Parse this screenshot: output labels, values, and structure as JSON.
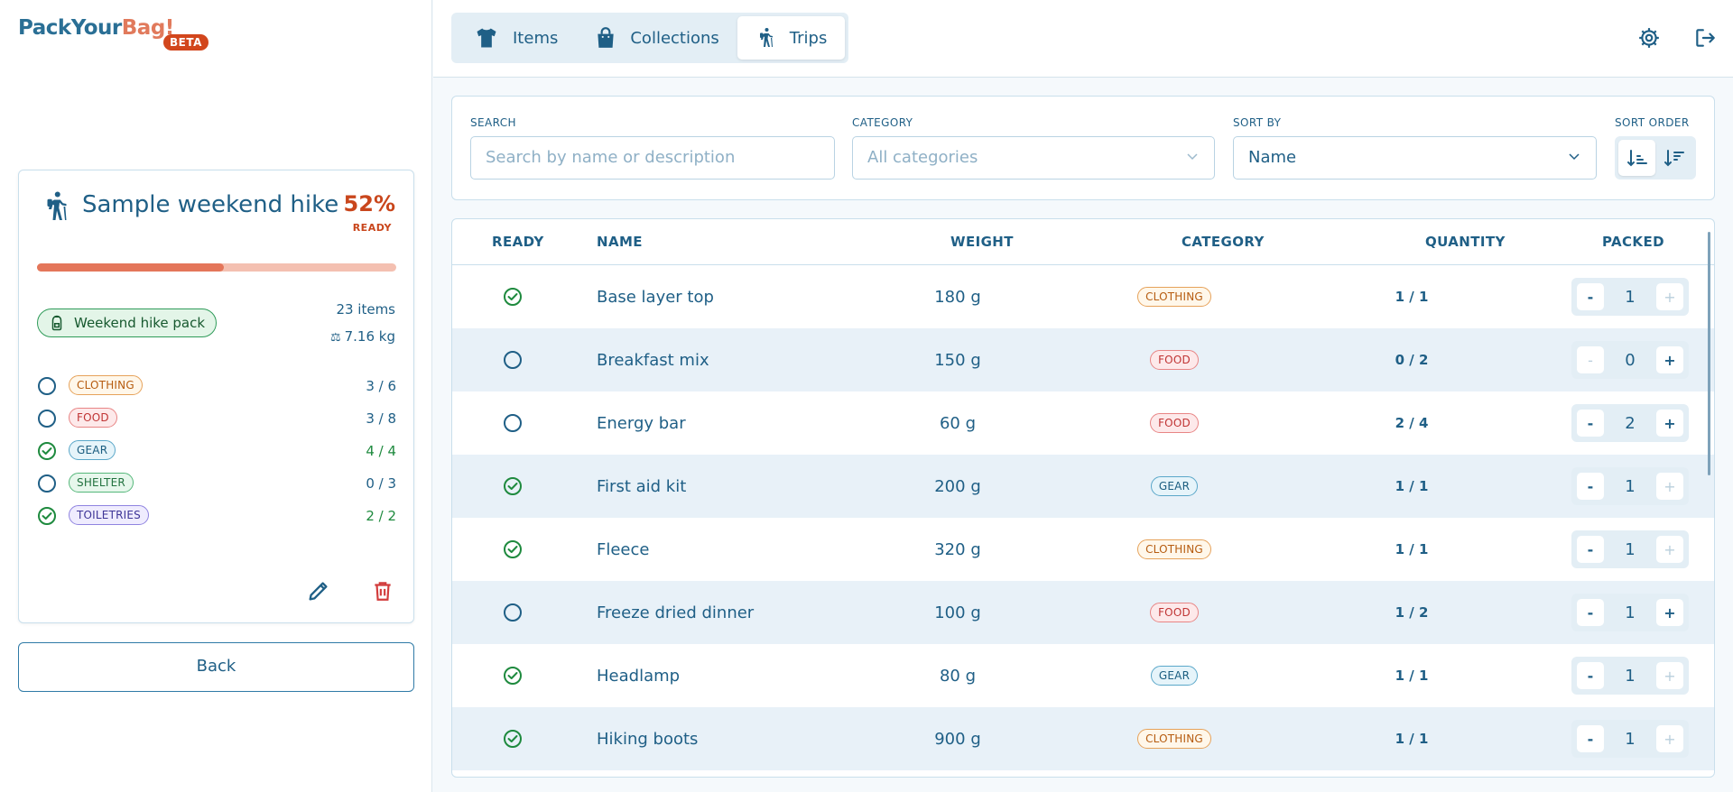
{
  "app": {
    "logo_part1": "PackYour",
    "logo_part2": "Bag!",
    "beta": "BETA"
  },
  "nav": {
    "tabs": [
      {
        "label": "Items",
        "icon": "shirt-icon"
      },
      {
        "label": "Collections",
        "icon": "bag-icon"
      },
      {
        "label": "Trips",
        "icon": "hiker-icon",
        "active": true
      }
    ]
  },
  "trip": {
    "title": "Sample weekend hike",
    "percent": "52%",
    "percent_value": 0.52,
    "ready_label": "READY",
    "pack_label": "Weekend hike pack",
    "items_count": "23 items",
    "weight": "7.16 kg",
    "categories": [
      {
        "label": "CLOTHING",
        "count": "3 / 6",
        "done": false
      },
      {
        "label": "FOOD",
        "count": "3 / 8",
        "done": false
      },
      {
        "label": "GEAR",
        "count": "4 / 4",
        "done": true
      },
      {
        "label": "SHELTER",
        "count": "0 / 3",
        "done": false
      },
      {
        "label": "TOILETRIES",
        "count": "2 / 2",
        "done": true
      }
    ]
  },
  "back_label": "Back",
  "filters": {
    "search_label": "SEARCH",
    "search_placeholder": "Search by name or description",
    "category_label": "CATEGORY",
    "category_value": "All categories",
    "sortby_label": "SORT BY",
    "sortby_value": "Name",
    "sortorder_label": "SORT ORDER"
  },
  "table": {
    "headers": [
      "READY",
      "NAME",
      "WEIGHT",
      "CATEGORY",
      "QUANTITY",
      "PACKED"
    ],
    "rows": [
      {
        "ready": true,
        "name": "Base layer top",
        "weight": "180 g",
        "category": "CLOTHING",
        "quantity": "1 / 1",
        "packed": "1"
      },
      {
        "ready": false,
        "name": "Breakfast mix",
        "weight": "150 g",
        "category": "FOOD",
        "quantity": "0 / 2",
        "packed": "0"
      },
      {
        "ready": false,
        "name": "Energy bar",
        "weight": "60 g",
        "category": "FOOD",
        "quantity": "2 / 4",
        "packed": "2"
      },
      {
        "ready": true,
        "name": "First aid kit",
        "weight": "200 g",
        "category": "GEAR",
        "quantity": "1 / 1",
        "packed": "1"
      },
      {
        "ready": true,
        "name": "Fleece",
        "weight": "320 g",
        "category": "CLOTHING",
        "quantity": "1 / 1",
        "packed": "1"
      },
      {
        "ready": false,
        "name": "Freeze dried dinner",
        "weight": "100 g",
        "category": "FOOD",
        "quantity": "1 / 2",
        "packed": "1"
      },
      {
        "ready": true,
        "name": "Headlamp",
        "weight": "80 g",
        "category": "GEAR",
        "quantity": "1 / 1",
        "packed": "1"
      },
      {
        "ready": true,
        "name": "Hiking boots",
        "weight": "900 g",
        "category": "CLOTHING",
        "quantity": "1 / 1",
        "packed": "1"
      }
    ]
  },
  "colors": {
    "accent": "#1f5f86",
    "progress": "#e4765a",
    "ready": "#1e8a3e",
    "danger": "#d23c3c"
  }
}
